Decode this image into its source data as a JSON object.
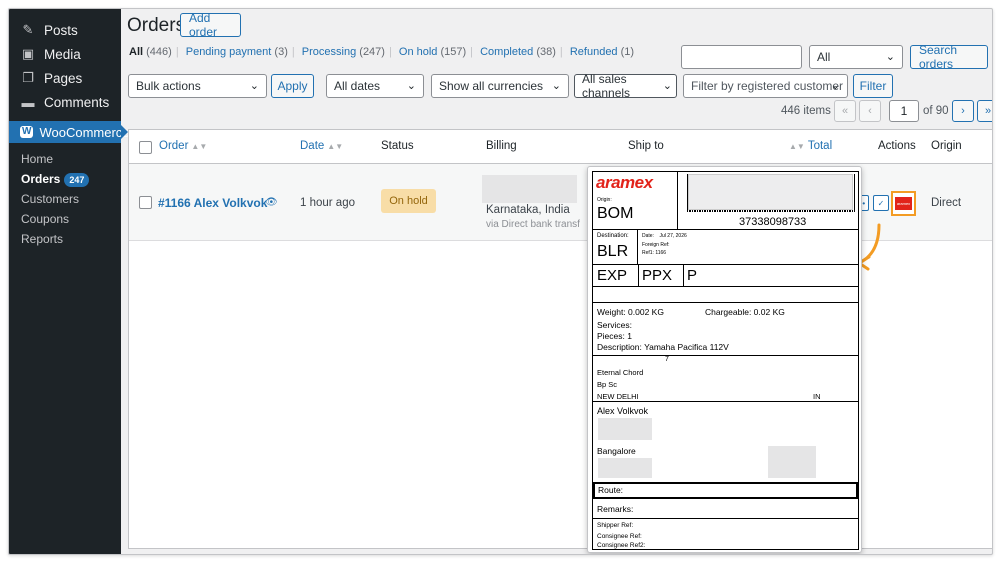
{
  "sidebar": {
    "items": [
      {
        "label": "Posts",
        "icon": "pin-icon"
      },
      {
        "label": "Media",
        "icon": "media-icon"
      },
      {
        "label": "Pages",
        "icon": "pages-icon"
      },
      {
        "label": "Comments",
        "icon": "comment-icon"
      }
    ],
    "woocommerce": "WooCommerce",
    "submenu": [
      "Home",
      "Orders",
      "Customers",
      "Coupons",
      "Reports"
    ],
    "orders_count": "247"
  },
  "header": {
    "title": "Orders",
    "add_order": "Add order"
  },
  "views": [
    {
      "label": "All",
      "count": "(446)"
    },
    {
      "label": "Pending payment",
      "count": "(3)"
    },
    {
      "label": "Processing",
      "count": "(247)"
    },
    {
      "label": "On hold",
      "count": "(157)"
    },
    {
      "label": "Completed",
      "count": "(38)"
    },
    {
      "label": "Refunded",
      "count": "(1)"
    }
  ],
  "search": {
    "value": "",
    "filter_value": "All",
    "button": "Search orders"
  },
  "filters": {
    "bulk": "Bulk actions",
    "apply": "Apply",
    "dates": "All dates",
    "currencies": "Show all currencies",
    "channels": "All sales channels",
    "customer": "Filter by registered customer",
    "filter": "Filter"
  },
  "pagination": {
    "items": "446 items",
    "first": "«",
    "prev": "‹",
    "page": "1",
    "of": "of 90",
    "next": "›",
    "last": "»"
  },
  "table": {
    "columns": [
      "Order",
      "Date",
      "Status",
      "Billing",
      "Ship to",
      "Total",
      "Actions",
      "Origin"
    ],
    "row": {
      "order": "#1166 Alex Volkvok",
      "date": "1 hour ago",
      "status": "On hold",
      "billing_line": "Karnataka, India",
      "billing_via": "via Direct bank transf",
      "origin": "Direct"
    }
  },
  "label": {
    "brand": "aramex",
    "origin_label": "Origin:",
    "origin": "BOM",
    "awb": "37338098733",
    "destination_label": "Destination:",
    "destination": "BLR",
    "date_label": "Date:",
    "date": "Jul 27, 2026",
    "foreign_ref": "Foreign Ref:",
    "ref1": "Ref1: 1166",
    "product": "EXP",
    "group": "PPX",
    "payment": "P",
    "weight": "Weight: 0.002 KG",
    "chargeable": "Chargeable: 0.02 KG",
    "services": "Services:",
    "pieces": "Pieces: 1",
    "description": "Description: Yamaha Pacifica 112V",
    "shipper_digit": "7",
    "shipper_name": "Eternal Chord",
    "shipper_line": "Bp Sc",
    "shipper_city": "NEW DELHI",
    "shipper_country": "IN",
    "consignee_name": "Alex Volkvok",
    "consignee_city": "Bangalore",
    "route": "Route:",
    "remarks": "Remarks:",
    "shipper_ref": "Shipper Ref:",
    "consignee_ref": "Consignee Ref:",
    "consignee_ref2": "Consignee Ref2:"
  },
  "colors": {
    "accent": "#2271b1",
    "aramex_red": "#e2231a",
    "highlight": "#f39c24",
    "on_hold_bg": "#f8dda7"
  }
}
